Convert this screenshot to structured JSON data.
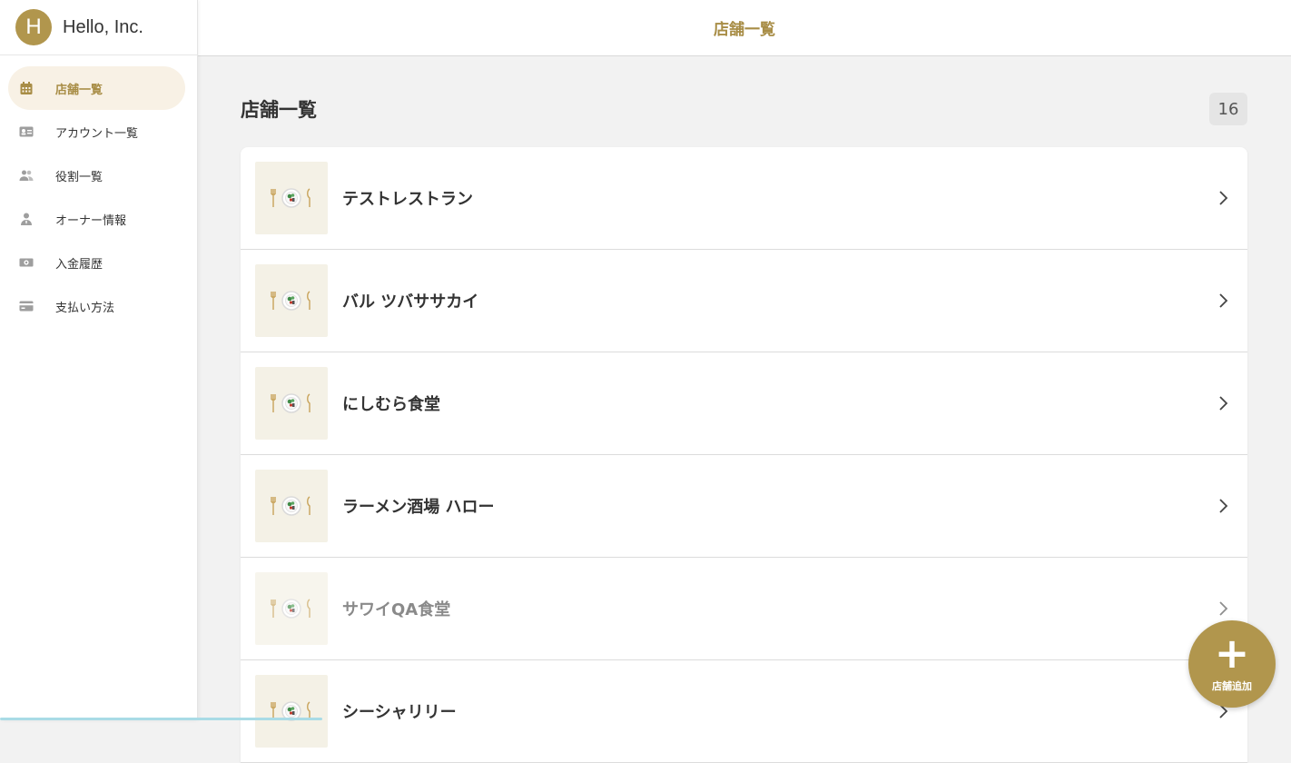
{
  "brand": {
    "initial": "H",
    "name": "Hello, Inc.",
    "color": "#b1964d"
  },
  "header": {
    "title": "店舗一覧"
  },
  "sidebar": {
    "items": [
      {
        "label": "店舗一覧",
        "icon": "calendar-icon",
        "active": true
      },
      {
        "label": "アカウント一覧",
        "icon": "id-card-icon",
        "active": false
      },
      {
        "label": "役割一覧",
        "icon": "people-icon",
        "active": false
      },
      {
        "label": "オーナー情報",
        "icon": "person-icon",
        "active": false
      },
      {
        "label": "入金履歴",
        "icon": "money-icon",
        "active": false
      },
      {
        "label": "支払い方法",
        "icon": "credit-card-icon",
        "active": false
      }
    ]
  },
  "main": {
    "title": "店舗一覧",
    "count": "16",
    "stores": [
      {
        "name": "テストレストラン"
      },
      {
        "name": "バル ツバササカイ"
      },
      {
        "name": "にしむら食堂"
      },
      {
        "name": "ラーメン酒場 ハロー"
      },
      {
        "name": "サワイQA食堂"
      },
      {
        "name": "シーシャリリー"
      }
    ]
  },
  "fab": {
    "icon": "plus-icon",
    "label": "店舗追加"
  },
  "colors": {
    "accent": "#a88d46",
    "active_bg": "#f8f1e5"
  }
}
